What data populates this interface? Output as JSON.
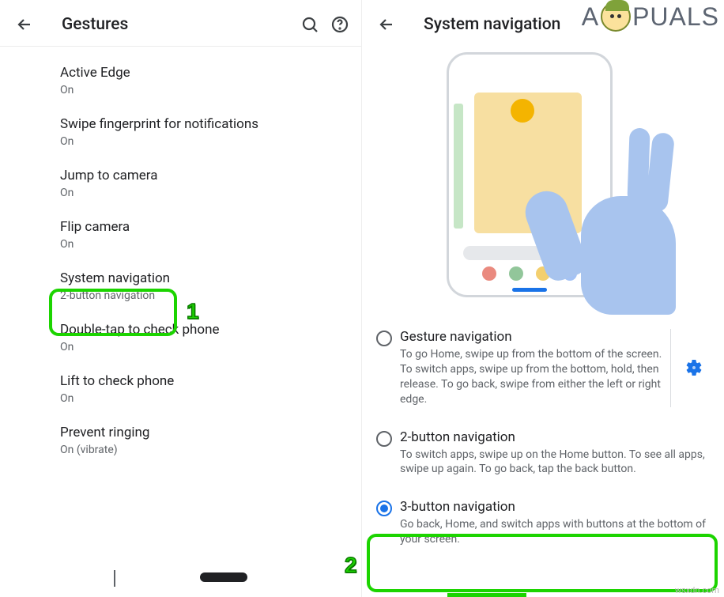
{
  "watermark": {
    "preA": "A",
    "post": "PUALS"
  },
  "left": {
    "title": "Gestures",
    "items": [
      {
        "label": "Active Edge",
        "sub": "On"
      },
      {
        "label": "Swipe fingerprint for notifications",
        "sub": "On"
      },
      {
        "label": "Jump to camera",
        "sub": "On"
      },
      {
        "label": "Flip camera",
        "sub": "On"
      },
      {
        "label": "System navigation",
        "sub": "2-button navigation"
      },
      {
        "label": "Double-tap to check phone",
        "sub": "On"
      },
      {
        "label": "Lift to check phone",
        "sub": "On"
      },
      {
        "label": "Prevent ringing",
        "sub": "On (vibrate)"
      }
    ]
  },
  "right": {
    "title": "System navigation",
    "options": [
      {
        "title": "Gesture navigation",
        "desc": "To go Home, swipe up from the bottom of the screen. To switch apps, swipe up from the bottom, hold, then release. To go back, swipe from either the left or right edge.",
        "selected": false,
        "gear": true
      },
      {
        "title": "2-button navigation",
        "desc": "To switch apps, swipe up on the Home button. To see all apps, swipe up again. To go back, tap the back button.",
        "selected": false,
        "gear": false
      },
      {
        "title": "3-button navigation",
        "desc": "Go back, Home, and switch apps with buttons at the bottom of your screen.",
        "selected": true,
        "gear": false
      }
    ]
  },
  "callouts": {
    "one": "1",
    "two": "2"
  },
  "source": "wsxdn.com"
}
